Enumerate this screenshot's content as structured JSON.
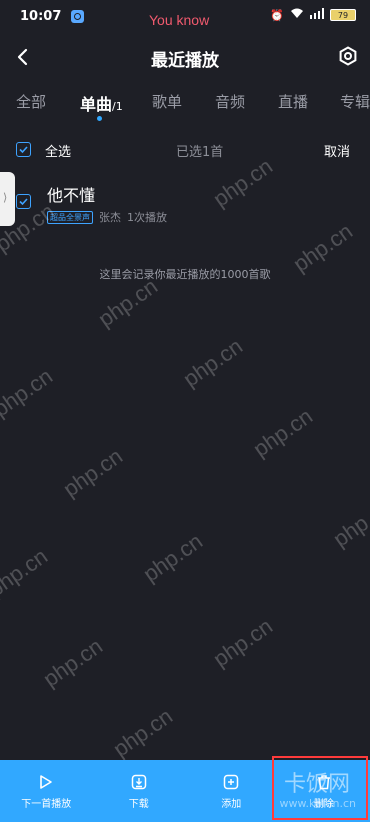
{
  "status_bar": {
    "time": "10:07",
    "overlay_text": "You know",
    "battery": "79"
  },
  "header": {
    "title": "最近播放"
  },
  "tabs": [
    {
      "label": "全部"
    },
    {
      "label": "单曲",
      "count": "/1",
      "active": true
    },
    {
      "label": "歌单"
    },
    {
      "label": "音频"
    },
    {
      "label": "直播"
    },
    {
      "label": "专辑"
    }
  ],
  "select_bar": {
    "select_all_label": "全选",
    "selected_count": "已选1首",
    "cancel_label": "取消"
  },
  "song": {
    "title": "他不懂",
    "badge": "超品全景声",
    "artist": "张杰",
    "plays": "1次播放",
    "checked": true
  },
  "hint": "这里会记录你最近播放的1000首歌",
  "bottom_bar": {
    "actions": [
      {
        "label": "下一首播放",
        "icon": "play-next-icon"
      },
      {
        "label": "下载",
        "icon": "download-icon"
      },
      {
        "label": "添加",
        "icon": "add-to-playlist-icon"
      },
      {
        "label": "删除",
        "icon": "delete-icon"
      }
    ]
  },
  "watermarks": {
    "site": "php.cn",
    "brand": "卡饭网",
    "brand_url": "www.kafan.cn"
  },
  "colors": {
    "background": "#1e1f26",
    "accent": "#31a8ff",
    "highlight": "#ff3b3b"
  }
}
